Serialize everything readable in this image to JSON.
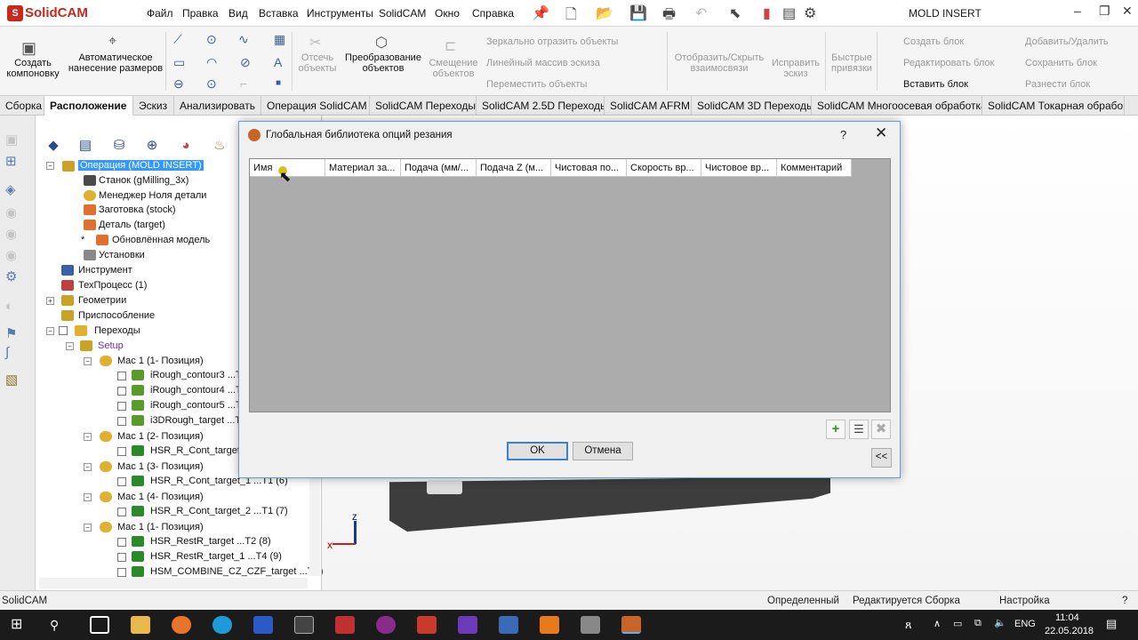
{
  "app": {
    "name": "SolidCAM",
    "document_title": "MOLD INSERT",
    "menu": [
      "Файл",
      "Правка",
      "Вид",
      "Вставка",
      "Инструменты",
      "SolidCAM",
      "Окно",
      "Справка"
    ]
  },
  "ribbon": {
    "create_layout": "Создать компоновку",
    "auto_dim": "Автоматическое нанесение размеров",
    "trim": "Отсечь объекты",
    "convert": "Преобразование объектов",
    "offset": "Смещение объектов",
    "mirror": "Зеркально отразить объекты",
    "linear_pattern": "Линейный массив эскиза",
    "move": "Переместить объекты",
    "show_hide": "Отобразить/Скрыть взаимосвязи",
    "repair": "Исправить эскиз",
    "quick_snaps": "Быстрые привязки",
    "create_block": "Создать блок",
    "edit_block": "Редактировать блок",
    "insert_block": "Вставить блок",
    "add_remove": "Добавить/Удалить",
    "save_block": "Сохранить блок",
    "explode_block": "Разнести блок"
  },
  "tabs": [
    "Сборка",
    "Расположение",
    "Эскиз",
    "Анализировать",
    "Операция SolidCAM",
    "SolidCAM Переходы",
    "SolidCAM 2.5D Переходы",
    "SolidCAM AFRM",
    "SolidCAM 3D Переходы",
    "SolidCAM Многоосевая обработка",
    "SolidCAM Токарная обрабо..."
  ],
  "tree": {
    "root": "Операция (MOLD INSERT)",
    "machine": "Станок (gMilling_3x)",
    "part_zero": "Менеджер Ноля детали",
    "stock": "Заготовка (stock)",
    "target": "Деталь (target)",
    "updated_model": "Обновлённая модель",
    "settings": "Установки",
    "tool": "Инструмент",
    "process": "ТехПроцесс (1)",
    "geometries": "Геометрии",
    "fixture": "Приспособление",
    "operations": "Переходы",
    "setup": "Setup",
    "mac1_pos1": "Mac 1 (1- Позиция)",
    "op1": "iRough_contour3 ...T",
    "op2": "iRough_contour4 ...T",
    "op3": "iRough_contour5 ...T",
    "op4": "i3DRough_target ...T",
    "mac1_pos2": "Mac 1 (2- Позиция)",
    "op5": "HSR_R_Cont_target ...",
    "mac1_pos3": "Mac 1 (3- Позиция)",
    "op6": "HSR_R_Cont_target_1 ...T1 (6)",
    "mac1_pos4": "Mac 1 (4- Позиция)",
    "op7": "HSR_R_Cont_target_2 ...T1 (7)",
    "mac1_pos1b": "Mac 1 (1- Позиция)",
    "op8": "HSR_RestR_target ...T2 (8)",
    "op9": "HSR_RestR_target_1 ...T4 (9)",
    "op10": "HSM_COMBINE_CZ_CZF_target ...T2 ("
  },
  "dialog": {
    "title": "Глобальная библиотека опций резания",
    "help": "?",
    "columns": [
      "Имя",
      "Материал за...",
      "Подача (мм/...",
      "Подача Z (м...",
      "Чистовая по...",
      "Скорость вр...",
      "Чистовое вр...",
      "Комментарий"
    ],
    "ok": "OK",
    "cancel": "Отмена",
    "collapse": "<<"
  },
  "status": {
    "app": "SolidCAM",
    "defined": "Определенный",
    "editing": "Редактируется Сборка",
    "settings": "Настройка"
  },
  "taskbar": {
    "lang": "ENG",
    "time": "11:04",
    "date": "22.05.2018"
  },
  "axes": {
    "x": "X",
    "z": "Z"
  },
  "colors": {
    "accent": "#3399ff",
    "brand": "#c8281e"
  }
}
